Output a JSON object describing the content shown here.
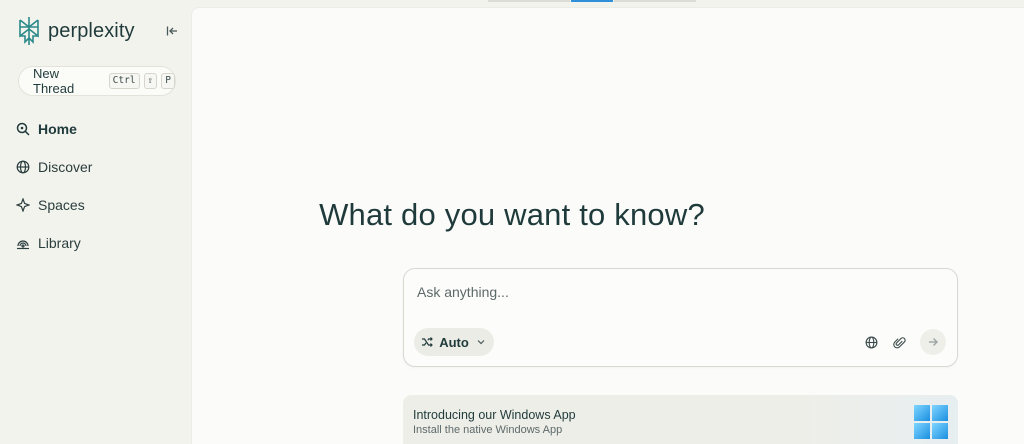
{
  "sidebar": {
    "brand": "perplexity",
    "new_thread": {
      "label": "New Thread",
      "keys": [
        "Ctrl",
        "⇧",
        "P"
      ]
    },
    "items": [
      {
        "label": "Home",
        "icon": "search-icon",
        "active": true
      },
      {
        "label": "Discover",
        "icon": "globe-icon",
        "active": false
      },
      {
        "label": "Spaces",
        "icon": "spaces-icon",
        "active": false
      },
      {
        "label": "Library",
        "icon": "library-icon",
        "active": false
      }
    ]
  },
  "main": {
    "heading": "What do you want to know?",
    "ask": {
      "placeholder": "Ask anything...",
      "mode_label": "Auto"
    },
    "promo": {
      "title": "Introducing our Windows App",
      "subtitle": "Install the native Windows App"
    }
  },
  "colors": {
    "accent": "#2f8fd8",
    "text": "#1f3a3a",
    "sidebar_bg": "#f3f3ee",
    "main_bg": "#fbfbf9"
  }
}
